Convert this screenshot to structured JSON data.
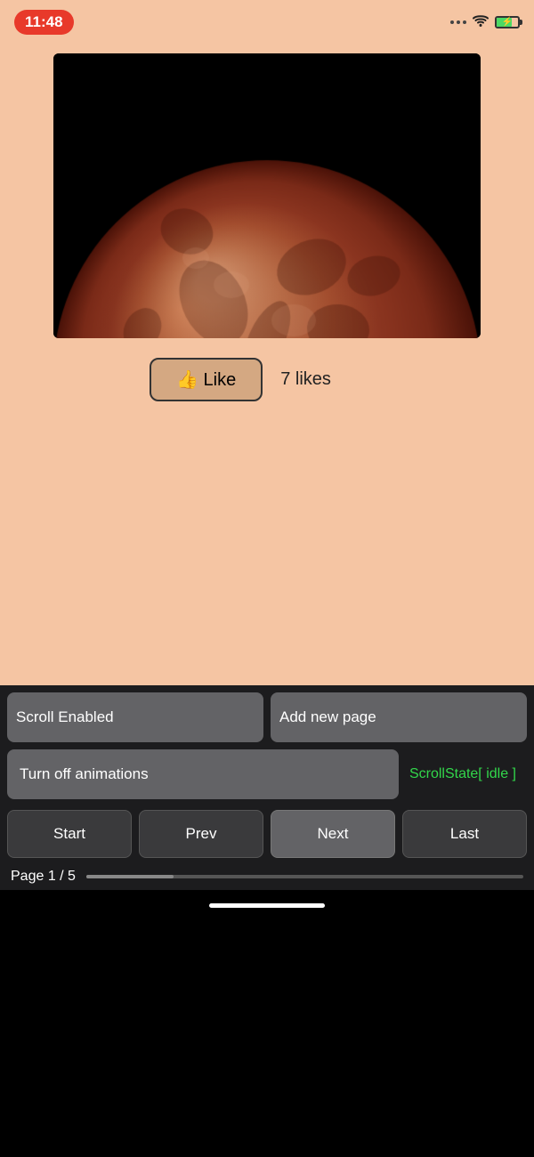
{
  "status_bar": {
    "time": "11:48",
    "battery_icon": "battery-icon"
  },
  "image": {
    "alt": "Blood moon / lunar eclipse photo"
  },
  "like_section": {
    "button_label": "👍 Like",
    "like_count": "7 likes"
  },
  "toolbar": {
    "scroll_enabled_label": "Scroll Enabled",
    "add_new_page_label": "Add new page",
    "turn_off_animations_label": "Turn off animations",
    "scroll_state_label": "ScrollState[ idle ]",
    "start_label": "Start",
    "prev_label": "Prev",
    "next_label": "Next",
    "last_label": "Last",
    "page_indicator": "Page 1 / 5"
  }
}
